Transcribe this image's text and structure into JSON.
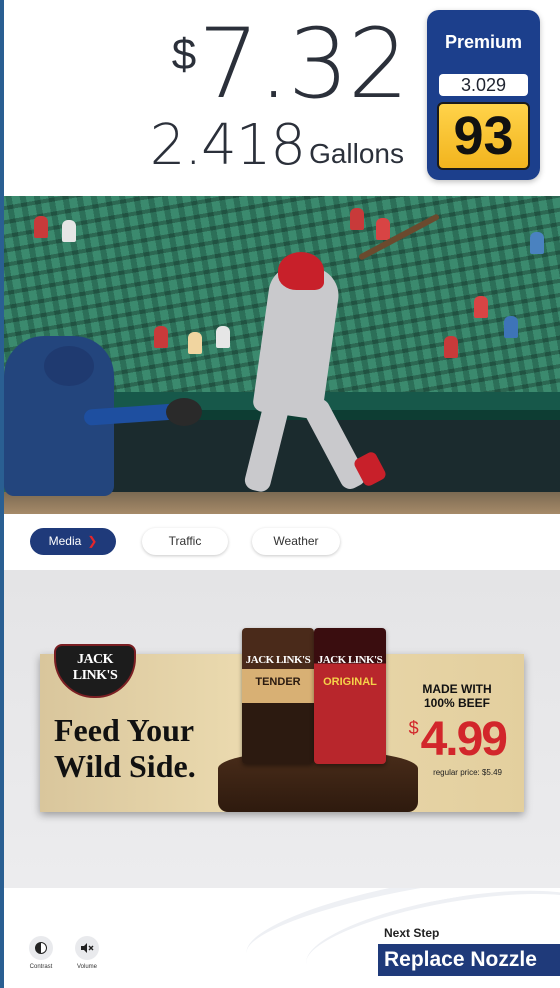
{
  "transaction": {
    "currency_symbol": "$",
    "price": "7.32",
    "gallons": "2.418",
    "gallons_unit": "Gallons"
  },
  "grade": {
    "name": "Premium",
    "price_per_gallon": "3.029",
    "octane": "93",
    "color": "#1c3f8c"
  },
  "tabs": [
    {
      "label": "Media",
      "active": true,
      "icon": "chevron-down-icon"
    },
    {
      "label": "Traffic",
      "active": false
    },
    {
      "label": "Weather",
      "active": false
    }
  ],
  "ad": {
    "brand": "JACK LINK'S",
    "headline": "Feed Your Wild Side.",
    "bag_left_flavor": "TENDER",
    "bag_right_flavor": "ORIGINAL",
    "made_with": "MADE WITH 100% BEEF",
    "price_symbol": "$",
    "price": "4.99",
    "regular_price": "regular price: $5.49"
  },
  "footer": {
    "contrast_label": "Contrast",
    "volume_label": "Volume",
    "next_step_label": "Next Step",
    "next_step_action": "Replace Nozzle"
  },
  "colors": {
    "brand_navy": "#1f3a7a",
    "octane_yellow": "#f2b41e",
    "accent_red": "#e4262b"
  }
}
